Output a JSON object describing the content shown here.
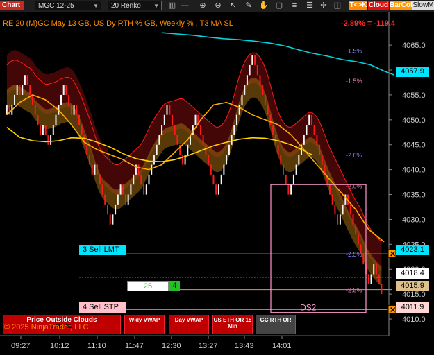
{
  "toolbar": {
    "title": "Chart",
    "instrument": "MGC 12-25",
    "bar_type": "20 Renko",
    "buttons": {
      "tk": "T<>K",
      "cloud": "Cloud",
      "barcol": "BarCol",
      "slow": "SlowM"
    },
    "icons": [
      "bars-icon",
      "dash-icon",
      "zoom-in-icon",
      "zoom-out-icon",
      "pointer-icon",
      "pencil-icon",
      "hand-icon",
      "box-icon",
      "lines-icon",
      "list-icon",
      "crosshair-icon",
      "chart-icon",
      "properties-icon",
      "flag-icon",
      "menu-icon"
    ]
  },
  "header": {
    "left": "RE 20  (M)GC May 13 GB, US Dy RTH % GB, Weekly % , T3 MA SL",
    "right": "-2.89% = -119.4",
    "right_color": "#ff2a2a"
  },
  "chart_data": {
    "type": "candlestick",
    "title": "",
    "instrument": "MGC 12-25",
    "bar_type": "20 Renko",
    "ylim": [
      4007.5,
      4068.5
    ],
    "y_ticks": [
      4010.0,
      4015.0,
      4020.0,
      4025.0,
      4030.0,
      4035.0,
      4040.0,
      4045.0,
      4050.0,
      4055.0,
      4060.0,
      4065.0
    ],
    "x_ticks": [
      "09:27",
      "10:12",
      "11:10",
      "11:47",
      "12:30",
      "13:27",
      "13:43",
      "14:01"
    ],
    "price_tags": [
      {
        "value": "4057.9",
        "price": 4057.9,
        "bg": "#00e5ff",
        "fg": "#000"
      },
      {
        "value": "4023.1",
        "price": 4023.1,
        "bg": "#00e5ff",
        "fg": "#000"
      },
      {
        "value": "4018.4",
        "price": 4018.4,
        "bg": "#ffffff",
        "fg": "#000"
      },
      {
        "value": "4015.9",
        "price": 4015.9,
        "bg": "#e0c08a",
        "fg": "#000"
      },
      {
        "value": "4011.9",
        "price": 4011.9,
        "bg": "#ffd6d6",
        "fg": "#000"
      }
    ],
    "percent_levels": [
      {
        "label": "-1.5%",
        "price": 4064.0,
        "color": "#8a8aff"
      },
      {
        "label": "-1.5%",
        "price": 4057.9,
        "color": "#e07ab0"
      },
      {
        "label": "-2.0%",
        "price": 4043.0,
        "color": "#8a8aff"
      },
      {
        "label": "-2.0%",
        "price": 4036.8,
        "color": "#e07ab0"
      },
      {
        "label": "-2.5%",
        "price": 4023.1,
        "color": "#8a8aff"
      },
      {
        "label": "-2.5%",
        "price": 4015.9,
        "color": "#e07ab0"
      }
    ],
    "signals": [
      {
        "label": "3 Sell LMT",
        "price": 4023.1,
        "color": "#00e5ff"
      },
      {
        "label": "4 Sell STP",
        "price": 4011.9,
        "color": "#ffb6c1"
      }
    ],
    "position_box": {
      "qty": "25",
      "count": "4"
    },
    "ds_label": "DS2",
    "ds_box": {
      "price_top": 4037.0,
      "price_bottom": 4011.3
    },
    "candles": [
      [
        4051,
        4053
      ],
      [
        4053,
        4051
      ],
      [
        4051,
        4053
      ],
      [
        4053,
        4055
      ],
      [
        4055,
        4057
      ],
      [
        4057,
        4055
      ],
      [
        4055,
        4057
      ],
      [
        4057,
        4059
      ],
      [
        4059,
        4057
      ],
      [
        4057,
        4055
      ],
      [
        4055,
        4053
      ],
      [
        4053,
        4051
      ],
      [
        4051,
        4049
      ],
      [
        4049,
        4047
      ],
      [
        4047,
        4049
      ],
      [
        4049,
        4047
      ],
      [
        4047,
        4045
      ],
      [
        4045,
        4047
      ],
      [
        4047,
        4049
      ],
      [
        4049,
        4051
      ],
      [
        4051,
        4053
      ],
      [
        4053,
        4055
      ],
      [
        4055,
        4057
      ],
      [
        4057,
        4055
      ],
      [
        4055,
        4053
      ],
      [
        4053,
        4051
      ],
      [
        4051,
        4053
      ],
      [
        4053,
        4051
      ],
      [
        4051,
        4049
      ],
      [
        4049,
        4047
      ],
      [
        4047,
        4045
      ],
      [
        4045,
        4043
      ],
      [
        4043,
        4041
      ],
      [
        4041,
        4039
      ],
      [
        4039,
        4041
      ],
      [
        4041,
        4039
      ],
      [
        4039,
        4037
      ],
      [
        4037,
        4035
      ],
      [
        4035,
        4033
      ],
      [
        4033,
        4031
      ],
      [
        4031,
        4029
      ],
      [
        4029,
        4031
      ],
      [
        4031,
        4033
      ],
      [
        4033,
        4035
      ],
      [
        4035,
        4037
      ],
      [
        4037,
        4035
      ],
      [
        4035,
        4033
      ],
      [
        4033,
        4035
      ],
      [
        4035,
        4037
      ],
      [
        4037,
        4039
      ],
      [
        4039,
        4041
      ],
      [
        4041,
        4039
      ],
      [
        4039,
        4037
      ],
      [
        4037,
        4035
      ],
      [
        4035,
        4037
      ],
      [
        4037,
        4039
      ],
      [
        4039,
        4041
      ],
      [
        4041,
        4043
      ],
      [
        4043,
        4045
      ],
      [
        4045,
        4047
      ],
      [
        4047,
        4049
      ],
      [
        4049,
        4051
      ],
      [
        4051,
        4053
      ],
      [
        4053,
        4051
      ],
      [
        4051,
        4049
      ],
      [
        4049,
        4047
      ],
      [
        4047,
        4045
      ],
      [
        4045,
        4043
      ],
      [
        4043,
        4041
      ],
      [
        4041,
        4043
      ],
      [
        4043,
        4045
      ],
      [
        4045,
        4047
      ],
      [
        4047,
        4049
      ],
      [
        4049,
        4051
      ],
      [
        4051,
        4049
      ],
      [
        4049,
        4047
      ],
      [
        4047,
        4045
      ],
      [
        4045,
        4043
      ],
      [
        4043,
        4041
      ],
      [
        4041,
        4039
      ],
      [
        4039,
        4037
      ],
      [
        4037,
        4035
      ],
      [
        4035,
        4037
      ],
      [
        4037,
        4039
      ],
      [
        4039,
        4041
      ],
      [
        4041,
        4043
      ],
      [
        4043,
        4045
      ],
      [
        4045,
        4047
      ],
      [
        4047,
        4049
      ],
      [
        4049,
        4051
      ],
      [
        4051,
        4053
      ],
      [
        4053,
        4055
      ],
      [
        4055,
        4057
      ],
      [
        4057,
        4059
      ],
      [
        4059,
        4061
      ],
      [
        4061,
        4063
      ],
      [
        4063,
        4061
      ],
      [
        4061,
        4059
      ],
      [
        4059,
        4057
      ],
      [
        4057,
        4055
      ],
      [
        4055,
        4053
      ],
      [
        4053,
        4051
      ],
      [
        4051,
        4049
      ],
      [
        4049,
        4047
      ],
      [
        4047,
        4045
      ],
      [
        4045,
        4043
      ],
      [
        4043,
        4041
      ],
      [
        4041,
        4039
      ],
      [
        4039,
        4037
      ],
      [
        4037,
        4035
      ],
      [
        4035,
        4037
      ],
      [
        4037,
        4039
      ],
      [
        4039,
        4041
      ],
      [
        4041,
        4043
      ],
      [
        4043,
        4045
      ],
      [
        4045,
        4047
      ],
      [
        4047,
        4049
      ],
      [
        4049,
        4051
      ],
      [
        4051,
        4049
      ],
      [
        4049,
        4047
      ],
      [
        4047,
        4045
      ],
      [
        4045,
        4043
      ],
      [
        4043,
        4041
      ],
      [
        4041,
        4039
      ],
      [
        4039,
        4037
      ],
      [
        4037,
        4035
      ],
      [
        4035,
        4033
      ],
      [
        4033,
        4031
      ],
      [
        4031,
        4029
      ],
      [
        4029,
        4031
      ],
      [
        4031,
        4033
      ],
      [
        4033,
        4035
      ],
      [
        4035,
        4033
      ],
      [
        4033,
        4031
      ],
      [
        4031,
        4029
      ],
      [
        4029,
        4027
      ],
      [
        4027,
        4025
      ],
      [
        4025,
        4023
      ],
      [
        4023,
        4021
      ],
      [
        4021,
        4019
      ],
      [
        4019,
        4017
      ],
      [
        4017,
        4019
      ],
      [
        4019,
        4021
      ],
      [
        4021,
        4019
      ],
      [
        4019,
        4017
      ],
      [
        4017,
        4015
      ]
    ],
    "ma_series": [
      {
        "name": "",
        "color": "#00d5e0",
        "points": [
          [
            60,
            4067.5
          ],
          [
            72,
            4067.0
          ],
          [
            78,
            4066.6
          ],
          [
            84,
            4066.3
          ],
          [
            90,
            4066.1
          ],
          [
            96,
            4065.8
          ],
          [
            102,
            4065.4
          ],
          [
            108,
            4064.8
          ],
          [
            112,
            4064.2
          ],
          [
            118,
            4063.4
          ],
          [
            124,
            4062.8
          ],
          [
            130,
            4062.1
          ],
          [
            136,
            4061.6
          ],
          [
            141,
            4061.0
          ],
          [
            146,
            4059.8
          ],
          [
            150,
            4059.0
          ]
        ]
      },
      {
        "name": "",
        "color": "#ffd400",
        "points": [
          [
            0,
            4048.5
          ],
          [
            5,
            4046.5
          ],
          [
            10,
            4045.8
          ],
          [
            15,
            4045.6
          ],
          [
            20,
            4045.8
          ],
          [
            25,
            4046.4
          ],
          [
            30,
            4046.3
          ],
          [
            35,
            4045.5
          ],
          [
            40,
            4044.5
          ],
          [
            45,
            4043.2
          ],
          [
            50,
            4042.2
          ],
          [
            55,
            4041.7
          ],
          [
            60,
            4041.6
          ],
          [
            65,
            4042.0
          ],
          [
            70,
            4042.8
          ],
          [
            75,
            4043.8
          ],
          [
            80,
            4044.8
          ],
          [
            85,
            4045.5
          ],
          [
            90,
            4046.1
          ],
          [
            95,
            4046.4
          ],
          [
            100,
            4046.3
          ],
          [
            105,
            4045.8
          ],
          [
            110,
            4045.0
          ],
          [
            115,
            4043.8
          ],
          [
            118,
            4043.0
          ]
        ]
      },
      {
        "name": "",
        "color": "#ffaa00",
        "points": [
          [
            0,
            4051.0
          ],
          [
            5,
            4053.5
          ],
          [
            10,
            4055.0
          ],
          [
            15,
            4054.0
          ],
          [
            20,
            4052.0
          ],
          [
            25,
            4049.0
          ],
          [
            30,
            4045.5
          ],
          [
            35,
            4044.0
          ],
          [
            40,
            4043.0
          ],
          [
            45,
            4042.0
          ],
          [
            50,
            4040.5
          ],
          [
            55,
            4040.0
          ],
          [
            60,
            4041.0
          ],
          [
            65,
            4043.5
          ],
          [
            70,
            4046.0
          ],
          [
            75,
            4050.0
          ],
          [
            80,
            4053.0
          ],
          [
            85,
            4053.5
          ],
          [
            90,
            4052.5
          ],
          [
            95,
            4051.0
          ],
          [
            100,
            4050.0
          ],
          [
            105,
            4049.0
          ],
          [
            110,
            4047.0
          ],
          [
            115,
            4044.0
          ],
          [
            120,
            4041.0
          ],
          [
            125,
            4038.0
          ],
          [
            130,
            4035.0
          ],
          [
            135,
            4032.0
          ],
          [
            140,
            4028.0
          ],
          [
            146,
            4025.5
          ]
        ]
      }
    ]
  },
  "footer": {
    "buttons": [
      {
        "label": "Price Outside Clouds",
        "sub": "3 MA SL"
      },
      {
        "label": "Wkly VWAP",
        "sub": ""
      },
      {
        "label": "Day VWAP",
        "sub": ""
      },
      {
        "label": "US ETH OR 15 Min",
        "sub": ""
      },
      {
        "label": "GC RTH OR",
        "sub": ""
      }
    ],
    "copyright": "© 2025 NinjaTrader, LLC"
  },
  "colors": {
    "bg": "#000000",
    "up": "#f5f5f5",
    "down": "#ff1a1a",
    "cloud_bear": "#5a0a0a",
    "cloud_band": "#a06a10"
  }
}
